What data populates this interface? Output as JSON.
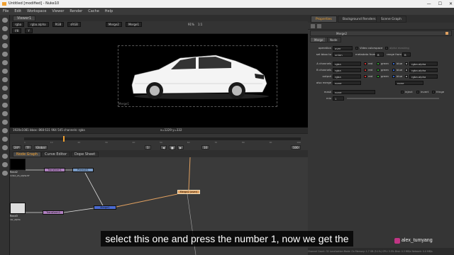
{
  "window": {
    "title": "Untitled [modified] - Nuke10",
    "controls": [
      "—",
      "☐",
      "✕"
    ]
  },
  "menu": [
    "File",
    "Edit",
    "Workspace",
    "Viewer",
    "Render",
    "Cache",
    "Help"
  ],
  "viewer": {
    "tab": "Viewer1",
    "channels": "rgba",
    "alpha_channel": "rgba.alpha",
    "colorspace": "RGB",
    "lut": "sRGB",
    "input_a": "Merge2",
    "input_b": "Merge1",
    "zoom": "91%",
    "ratio": "1:1",
    "frame_field": "f/8",
    "y_field": "Y",
    "info_left": "1920x1081 bbox: 868 631 964 545 channels: rgba",
    "info_right": "x=1229 y=332",
    "bbox_label": "Merge1"
  },
  "timeline": {
    "ticks": [
      "1",
      "10",
      "20",
      "30",
      "40",
      "50",
      "60",
      "70",
      "80",
      "90",
      "100"
    ],
    "fps": "24*",
    "mode": "TF",
    "range": "Global",
    "frame": "1",
    "end_frame": "100",
    "step": "10"
  },
  "nodegraph": {
    "tabs": [
      "Node Graph",
      "Curve Editor",
      "Dope Sheet"
    ],
    "nodes": {
      "read2": "Read2",
      "read2_file": "rodeo_sh_alpha.tif",
      "read2_sub": "(alpha)",
      "read3": "Read3",
      "read3_file": "car_alpha",
      "transform1": "Transform1",
      "premult1": "Premult1",
      "transform2": "Transform2",
      "merge1": "Merge1",
      "merge2": "Merge2 (over)",
      "viewer": "Viewer1"
    }
  },
  "properties": {
    "tabs": [
      "Properties",
      "Background Renders",
      "Scene Graph"
    ],
    "node_name": "Merge2",
    "inner_tabs": [
      "Merge",
      "Node"
    ],
    "operation_label": "operation",
    "operation": "over",
    "video_colorspace": "Video colorspace",
    "alpha_masking": "alpha masking",
    "set_bbox_label": "set bbox to",
    "set_bbox": "union",
    "metadata_from_label": "metadata from",
    "metadata_from": "B",
    "range_from_label": "range from",
    "range_from": "B",
    "a_channels_label": "A channels",
    "a_channels": "rgba",
    "b_channels_label": "B channels",
    "b_channels": "rgba",
    "output_label": "output",
    "output": "rgba",
    "also_merge_label": "also merge",
    "also_merge": "none",
    "also_merge2": "none",
    "ch_red": "red",
    "ch_green": "green",
    "ch_blue": "blue",
    "ch_alpha": "rgba.alpha",
    "mask_label": "mask",
    "mask": "none",
    "inject": "inject",
    "invert": "invert",
    "fringe": "fringe",
    "mix_label": "mix",
    "mix": "1"
  },
  "status": "Channel Count: 32 Localization Mode: On Memory: 1.7 GB (5.1%) CPU: 3.5% Disk: 0.3 MB/s Network: 0.0 MB/s",
  "subtitle": "select this one and press the number 1, now we get the",
  "watermark": "alex_tumyang",
  "colors": {
    "accent": "#f0a030",
    "node_selected": "#e0a060"
  }
}
